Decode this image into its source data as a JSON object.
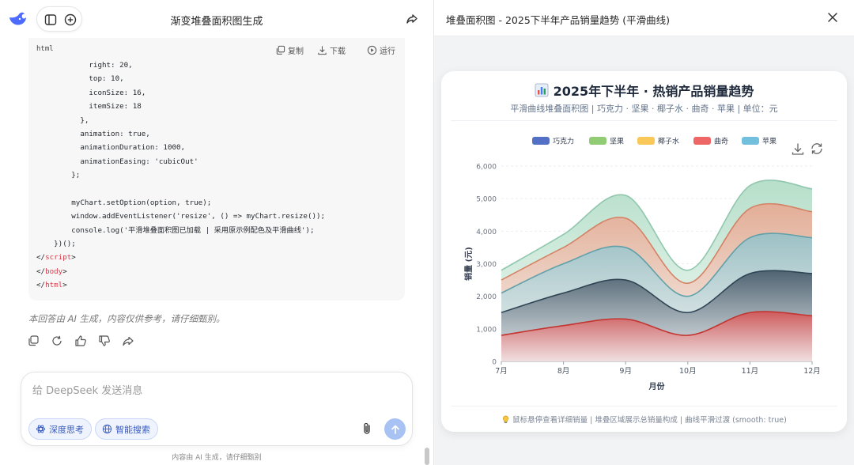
{
  "chat": {
    "title": "渐变堆叠面积图生成",
    "code_lang": "html",
    "code_actions": {
      "copy": "复制",
      "download": "下载",
      "run": "运行"
    },
    "code_lines": [
      {
        "text": "            right: 20,"
      },
      {
        "text": "            top: 10,"
      },
      {
        "text": "            iconSize: 16,"
      },
      {
        "text": "            itemSize: 18"
      },
      {
        "text": "          },"
      },
      {
        "text": "          animation: true,"
      },
      {
        "text": "          animationDuration: 1000,"
      },
      {
        "text": "          animationEasing: 'cubicOut'"
      },
      {
        "text": "        };"
      },
      {
        "text": ""
      },
      {
        "text": "        myChart.setOption(option, true);"
      },
      {
        "text": "        window.addEventListener('resize', () => myChart.resize());"
      },
      {
        "text": "        console.log('平滑堆叠面积图已加载 | 采用原示例配色及平滑曲线');"
      },
      {
        "text": "    })();"
      },
      {
        "pre": "</",
        "tag": "script",
        "post": ">"
      },
      {
        "pre": "</",
        "tag": "body",
        "post": ">"
      },
      {
        "pre": "</",
        "tag": "html",
        "post": ">"
      }
    ],
    "disclaimer": "本回答由 AI 生成，内容仅供参考，请仔细甄别。",
    "input_placeholder": "给 DeepSeek 发送消息",
    "chip_deep_think": "深度思考",
    "chip_search": "智能搜索",
    "footer_note": "内容由 AI 生成，请仔细甄别"
  },
  "panel": {
    "title": "堆叠面积图 - 2025下半年产品销量趋势 (平滑曲线)",
    "card_title": "2025年下半年 · 热销产品销量趋势",
    "card_subtitle": "平滑曲线堆叠面积图 | 巧克力 · 坚果 · 椰子水 · 曲奇 · 苹果 | 单位：元",
    "card_footer": "鼠标悬停查看详细销量 | 堆叠区域展示总销量构成 | 曲线平滑过渡 (smooth: true)"
  },
  "chart_data": {
    "type": "area",
    "stacked": true,
    "smooth": true,
    "categories": [
      "7月",
      "8月",
      "9月",
      "10月",
      "11月",
      "12月"
    ],
    "xlabel": "月份",
    "ylabel": "销量 (元)",
    "ylim": [
      0,
      6000
    ],
    "yticks": [
      "0",
      "1,000",
      "2,000",
      "3,000",
      "4,000",
      "5,000",
      "6,000"
    ],
    "legend_position": "top",
    "grid": true,
    "series": [
      {
        "name": "巧克力",
        "legend_color": "#5470c6",
        "line": "#c23531",
        "top": "#d94e4e",
        "bottom": "#f6dada",
        "values": [
          800,
          1100,
          1300,
          800,
          1500,
          1400
        ]
      },
      {
        "name": "坚果",
        "legend_color": "#91cc75",
        "line": "#2f4554",
        "top": "#3d5060",
        "bottom": "#e0e4e8",
        "values": [
          700,
          1000,
          1200,
          700,
          1200,
          1300
        ]
      },
      {
        "name": "椰子水",
        "legend_color": "#fac858",
        "line": "#61a0a8",
        "top": "#8fc2cb",
        "bottom": "#e8f3f5",
        "values": [
          600,
          900,
          1000,
          500,
          1100,
          1100
        ]
      },
      {
        "name": "曲奇",
        "legend_color": "#ee6666",
        "line": "#d48265",
        "top": "#e9a48d",
        "bottom": "#fbece6",
        "values": [
          400,
          500,
          900,
          400,
          900,
          800
        ]
      },
      {
        "name": "苹果",
        "legend_color": "#73c0de",
        "line": "#91c7ae",
        "top": "#a9d9c0",
        "bottom": "#eaf6ef",
        "values": [
          300,
          400,
          700,
          400,
          700,
          700
        ]
      }
    ]
  }
}
